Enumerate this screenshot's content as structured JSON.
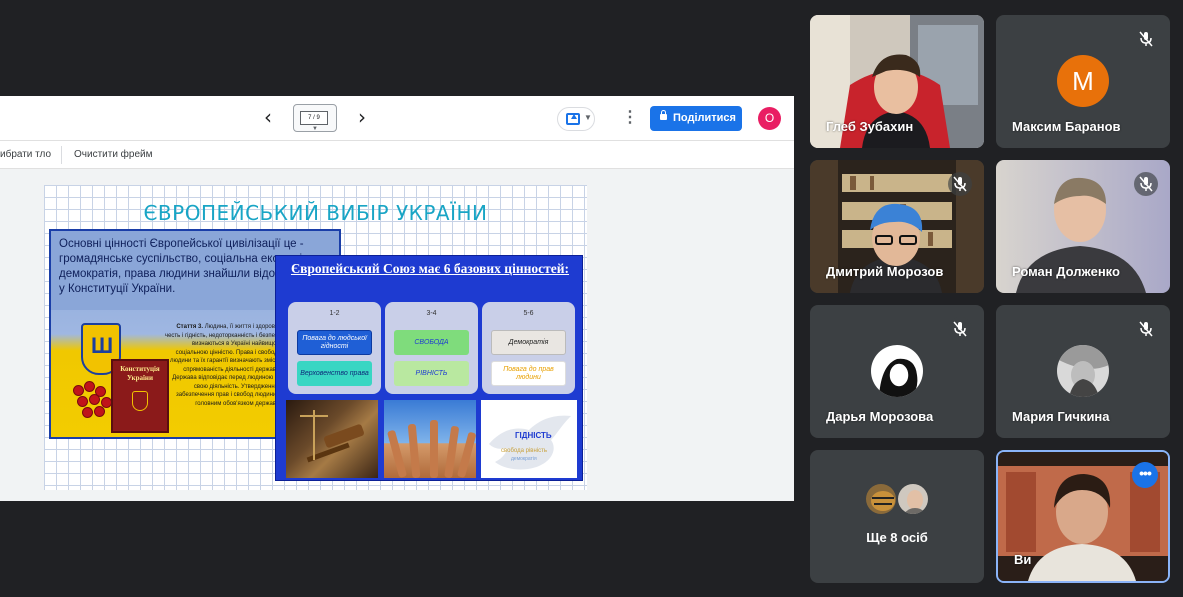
{
  "presentation": {
    "slide_counter": "7 / 9",
    "share_label": "Поділитися",
    "account_initial": "O",
    "toolbar": {
      "change_background": "ибрати тло",
      "clear_frame": "Очистити фрейм"
    },
    "slide": {
      "title": "ЄВРОПЕЙСЬКИЙ ВИБІР УКРАЇНИ",
      "left_text": "Основні цінності Європейської цивілізації це - громадянське суспільство, соціальна економіка, демократія, права людини знайшли відображення у Конституції України.",
      "constitution_label": "Конституція України",
      "article_heading": "Стаття 3.",
      "article_text": "Людина, її життя і здоров'я, честь і гідність, недоторканність і безпека визнаються в Україні найвищою соціальною цінністю. Права і свободи людини та їх гарантії визначають зміст і спрямованість діяльності держави. Держава відповідає перед людиною за свою діяльність. Утвердження і забезпечення прав і свобод людини є головним обов'язком держави.",
      "eu_title": "Європейський Союз має 6 базових цінностей:",
      "cards": [
        {
          "range": "1-2",
          "values": [
            "Повага до людської гідності",
            "Верховенство права"
          ]
        },
        {
          "range": "3-4",
          "values": [
            "СВОБОДА",
            "РІВНІСТЬ"
          ]
        },
        {
          "range": "5-6",
          "values": [
            "Демократія",
            "Повага до прав людини"
          ]
        }
      ],
      "wordcloud_word": "ГІДНІСТЬ"
    }
  },
  "participants": [
    {
      "name": "Глеб Зубахин",
      "muted": false
    },
    {
      "name": "Максим Баранов",
      "initial": "M",
      "avatar_color": "#e8710a",
      "muted": true
    },
    {
      "name": "Дмитрий Морозов",
      "muted": true
    },
    {
      "name": "Роман Долженко",
      "muted": true
    },
    {
      "name": "Дарья Морозова",
      "muted": true
    },
    {
      "name": "Мария Гичкина",
      "muted": true
    }
  ],
  "more": {
    "label": "Ще 8 осіб"
  },
  "self": {
    "name": "Ви"
  }
}
